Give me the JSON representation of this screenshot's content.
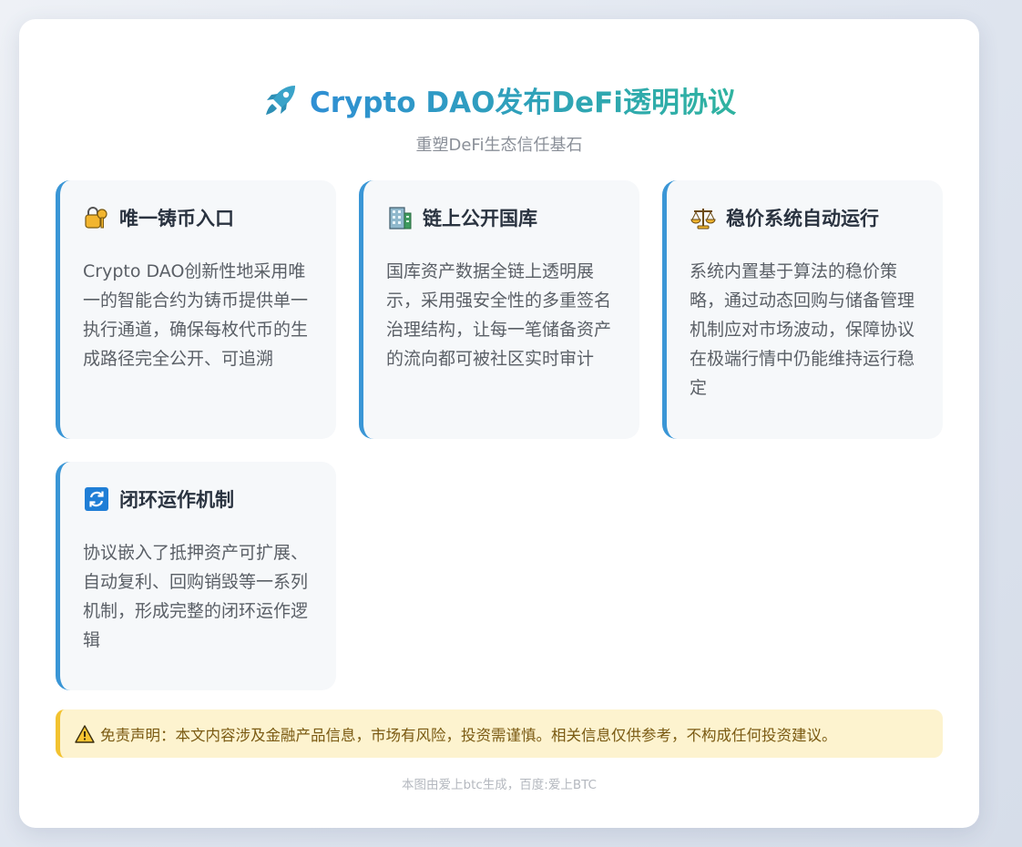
{
  "header": {
    "title": "Crypto DAO发布DeFi透明协议",
    "subtitle": "重塑DeFi生态信任基石",
    "icon": "rocket-icon"
  },
  "features": [
    {
      "icon": "lock-key-icon",
      "title": "唯一铸币入口",
      "text": "Crypto DAO创新性地采用唯一的智能合约为铸币提供单一执行通道，确保每枚代币的生成路径完全公开、可追溯"
    },
    {
      "icon": "building-icon",
      "title": "链上公开国库",
      "text": "国库资产数据全链上透明展示，采用强安全性的多重签名治理结构，让每一笔储备资产的流向都可被社区实时审计"
    },
    {
      "icon": "balance-scale-icon",
      "title": "稳价系统自动运行",
      "text": "系统内置基于算法的稳价策略，通过动态回购与储备管理机制应对市场波动，保障协议在极端行情中仍能维持运行稳定"
    },
    {
      "icon": "cycle-arrows-icon",
      "title": "闭环运作机制",
      "text": "协议嵌入了抵押资产可扩展、自动复利、回购销毁等一系列机制，形成完整的闭环运作逻辑"
    }
  ],
  "notice": {
    "icon": "warning-icon",
    "text": "免责声明：本文内容涉及金融产品信息，市场有风险，投资需谨慎。相关信息仅供参考，不构成任何投资建议。"
  },
  "footer": {
    "text": "本图由爱上btc生成，百度:爱上BTC"
  },
  "colors": {
    "accent": "#3a96d6",
    "title_gradient_start": "#2f8fd4",
    "title_gradient_end": "#2fb3a0",
    "notice_border": "#f2c230",
    "notice_bg": "#fdf3cf"
  }
}
